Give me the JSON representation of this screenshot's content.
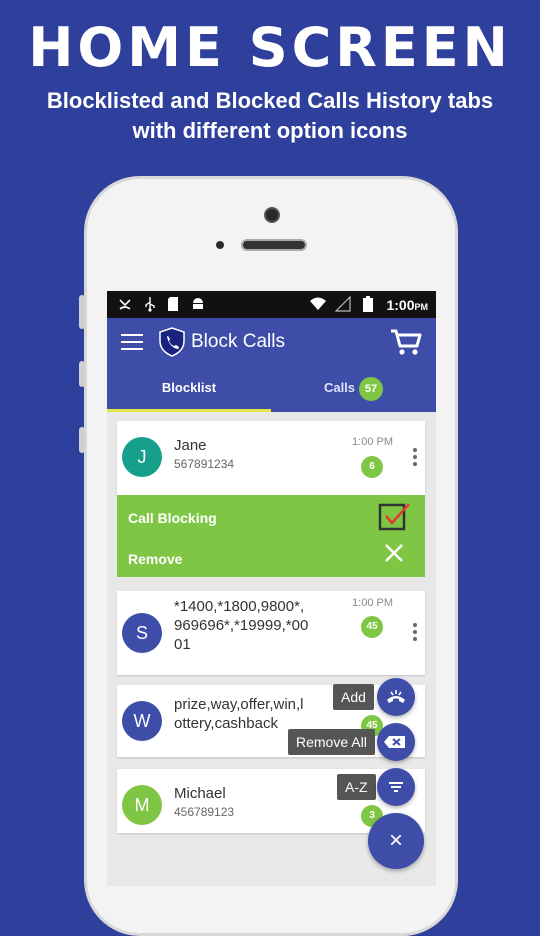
{
  "promo": {
    "title": "HOME SCREEN",
    "subtitle_line1": "Blocklisted and Blocked Calls History tabs",
    "subtitle_line2": "with different option icons"
  },
  "status": {
    "time": "1:00",
    "ampm": "PM"
  },
  "app": {
    "title": "Block Calls"
  },
  "tabs": {
    "blocklist": "Blocklist",
    "calls": "Calls",
    "calls_count": "57"
  },
  "contacts": [
    {
      "initial": "J",
      "name": "Jane",
      "number": "567891234",
      "time": "1:00 PM",
      "count": "6",
      "color": "#16a08c"
    },
    {
      "initial": "S",
      "name": "*1400,*1800,9800*,",
      "name2": "969696*,*19999,*00",
      "name3": "01",
      "time": "1:00 PM",
      "count": "45",
      "color": "#3d4da8"
    },
    {
      "initial": "W",
      "name": "prize,way,offer,win,l",
      "name2": "ottery,cashback",
      "count": "45",
      "color": "#3d4da8"
    },
    {
      "initial": "M",
      "name": "Michael",
      "number": "456789123",
      "count": "3",
      "color": "#7fc645"
    }
  ],
  "actions": {
    "call_blocking": "Call Blocking",
    "remove": "Remove"
  },
  "fab": {
    "add": "Add",
    "remove_all": "Remove All",
    "az": "A-Z",
    "close": "×"
  },
  "colors": {
    "background": "#2f3f9c",
    "primary": "#3d4da8",
    "accent_green": "#7fc645",
    "tab_indicator": "#e7e44a"
  }
}
